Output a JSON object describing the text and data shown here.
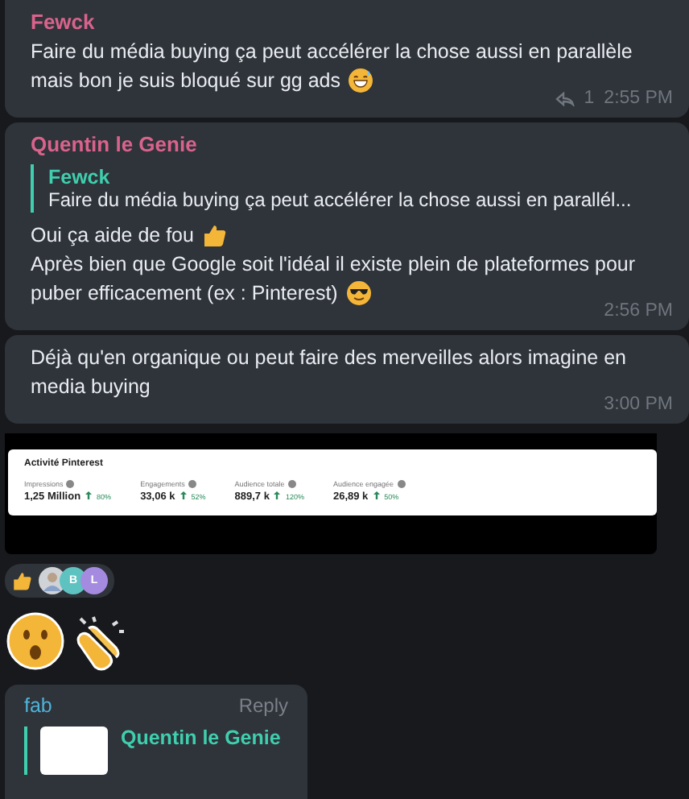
{
  "messages": [
    {
      "kind": "text",
      "author": "Fewck",
      "lines": [
        "Faire du média buying ça peut accélérer la chose aussi en parallèle",
        "mais bon je suis bloqué sur gg ads"
      ],
      "replies": "1",
      "time": "2:55 PM"
    },
    {
      "kind": "reply",
      "author": "Quentin le Genie",
      "quote": {
        "author": "Fewck",
        "text": "Faire du média buying ça peut accélérer la chose aussi en parallél..."
      },
      "lines": [
        "Oui ça aide de fou",
        "Après bien que Google soit l'idéal il existe plein de plateformes pour",
        "puber efficacement (ex : Pinterest)"
      ],
      "time": "2:56 PM"
    },
    {
      "kind": "plain",
      "lines": [
        "Déjà qu'en organique ou peut faire des merveilles alors imagine en",
        "media buying"
      ],
      "time": "3:00 PM"
    }
  ],
  "image": {
    "title": "Activité Pinterest",
    "stats": [
      {
        "label": "Impressions",
        "value": "1,25 Million",
        "change": "80%"
      },
      {
        "label": "Engagements",
        "value": "33,06 k",
        "change": "52%"
      },
      {
        "label": "Audience totale",
        "value": "889,7 k",
        "change": "120%"
      },
      {
        "label": "Audience engagée",
        "value": "26,89 k",
        "change": "50%"
      }
    ]
  },
  "reactions": {
    "avatars": [
      {
        "kind": "photo"
      },
      {
        "kind": "initials",
        "text": "B",
        "color": "#5ec3c0"
      },
      {
        "kind": "initials",
        "text": "L",
        "color": "#a58be0"
      }
    ]
  },
  "last": {
    "author": "fab",
    "action": "Reply",
    "quote_author": "Quentin le Genie"
  }
}
